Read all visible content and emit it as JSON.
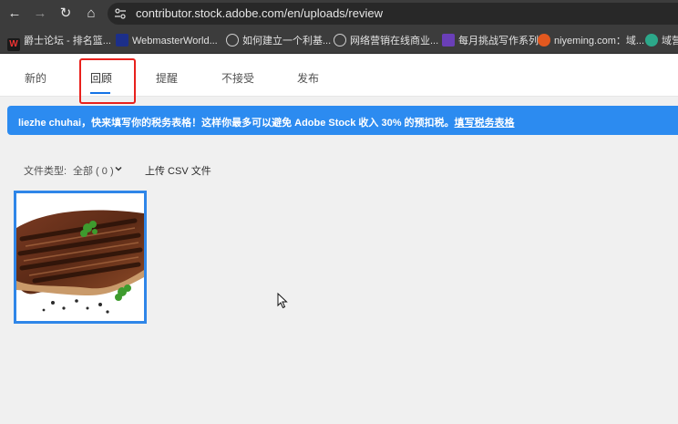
{
  "browser": {
    "url": "contributor.stock.adobe.com/en/uploads/review",
    "bookmarks": [
      {
        "label": "爵士论坛 - 排名篮...",
        "icon": "jazz-forum-icon"
      },
      {
        "label": "WebmasterWorld...",
        "icon": "webmasterworld-icon"
      },
      {
        "label": "如何建立一个利基...",
        "icon": "globe-icon"
      },
      {
        "label": "网络营销在线商业...",
        "icon": "globe-icon"
      },
      {
        "label": "每月挑战写作系列",
        "icon": "challenge-icon"
      },
      {
        "label": "niyeming.com：域...",
        "icon": "niyeming-icon"
      },
      {
        "label": "域营",
        "icon": "domain-icon"
      }
    ]
  },
  "tabs": [
    {
      "label": "新的",
      "active": false
    },
    {
      "label": "回顾",
      "active": true
    },
    {
      "label": "提醒",
      "active": false
    },
    {
      "label": "不接受",
      "active": false
    },
    {
      "label": "发布",
      "active": false
    }
  ],
  "banner": {
    "message": "liezhe chuhai，快来填写你的税务表格！这样你最多可以避免 Adobe Stock 收入 30% 的预扣税。",
    "link": "填写税务表格",
    "color": "#2c8bf0"
  },
  "filter": {
    "label": "文件类型:",
    "value": "全部 ( 0 )"
  },
  "upload_csv": "上传 CSV 文件",
  "thumbnail": {
    "subject": "grilled steak with herbs and peppercorns",
    "selected": true
  },
  "colors": {
    "accent": "#1473e6",
    "highlight": "#e8211d"
  }
}
